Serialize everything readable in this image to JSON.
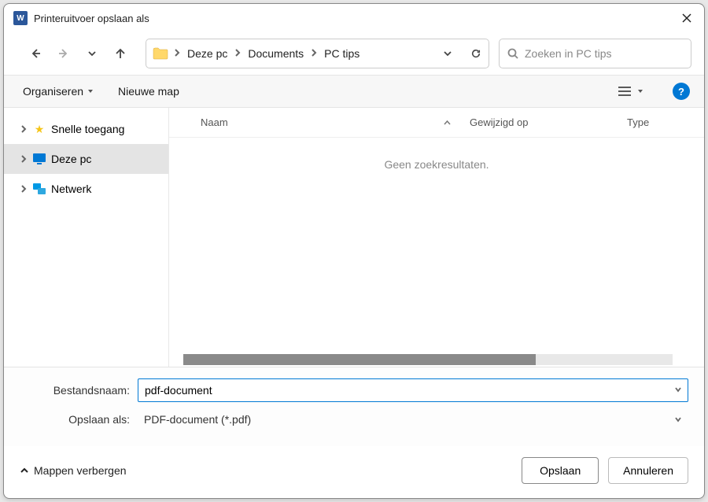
{
  "window": {
    "title": "Printeruitvoer opslaan als"
  },
  "nav": {
    "breadcrumbs": [
      "Deze pc",
      "Documents",
      "PC tips"
    ]
  },
  "search": {
    "placeholder": "Zoeken in PC tips"
  },
  "toolbar": {
    "organize": "Organiseren",
    "new_folder": "Nieuwe map"
  },
  "tree": {
    "items": [
      {
        "label": "Snelle toegang",
        "icon": "star"
      },
      {
        "label": "Deze pc",
        "icon": "pc",
        "selected": true
      },
      {
        "label": "Netwerk",
        "icon": "network"
      }
    ]
  },
  "columns": {
    "name": "Naam",
    "modified": "Gewijzigd op",
    "type": "Type"
  },
  "empty": "Geen zoekresultaten.",
  "form": {
    "filename_label": "Bestandsnaam:",
    "filename_value": "pdf-document",
    "saveas_label": "Opslaan als:",
    "saveas_value": "PDF-document (*.pdf)"
  },
  "footer": {
    "hide_folders": "Mappen verbergen",
    "save": "Opslaan",
    "cancel": "Annuleren"
  }
}
